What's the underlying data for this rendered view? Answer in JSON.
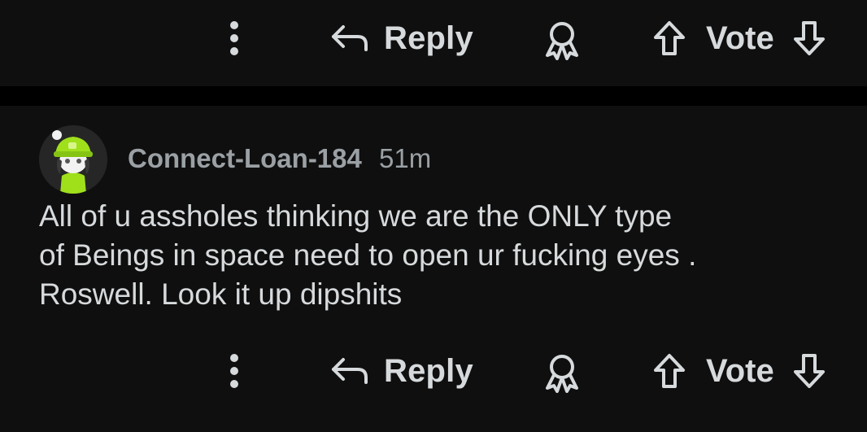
{
  "top_actions": {
    "more_icon": "more-vertical-icon",
    "reply_icon": "reply-arrow-icon",
    "reply_label": "Reply",
    "award_icon": "award-ribbon-icon",
    "upvote_icon": "arrow-up-icon",
    "vote_label": "Vote",
    "downvote_icon": "arrow-down-icon"
  },
  "comment": {
    "author": "Connect-Loan-184",
    "time": "51m",
    "avatar": "snoo-avatar-green-beanie",
    "body_lines": [
      "All of u assholes thinking we are the ONLY type",
      "of Beings in space need to open ur fucking eyes .",
      "Roswell. Look it up dipshits"
    ],
    "actions": {
      "reply_label": "Reply",
      "vote_label": "Vote"
    }
  },
  "colors": {
    "background": "#0f0f0f",
    "separator": "#000000",
    "text": "#d7dadc",
    "meta_text": "#9aa0a4",
    "avatar_accent": "#9fe01b"
  }
}
